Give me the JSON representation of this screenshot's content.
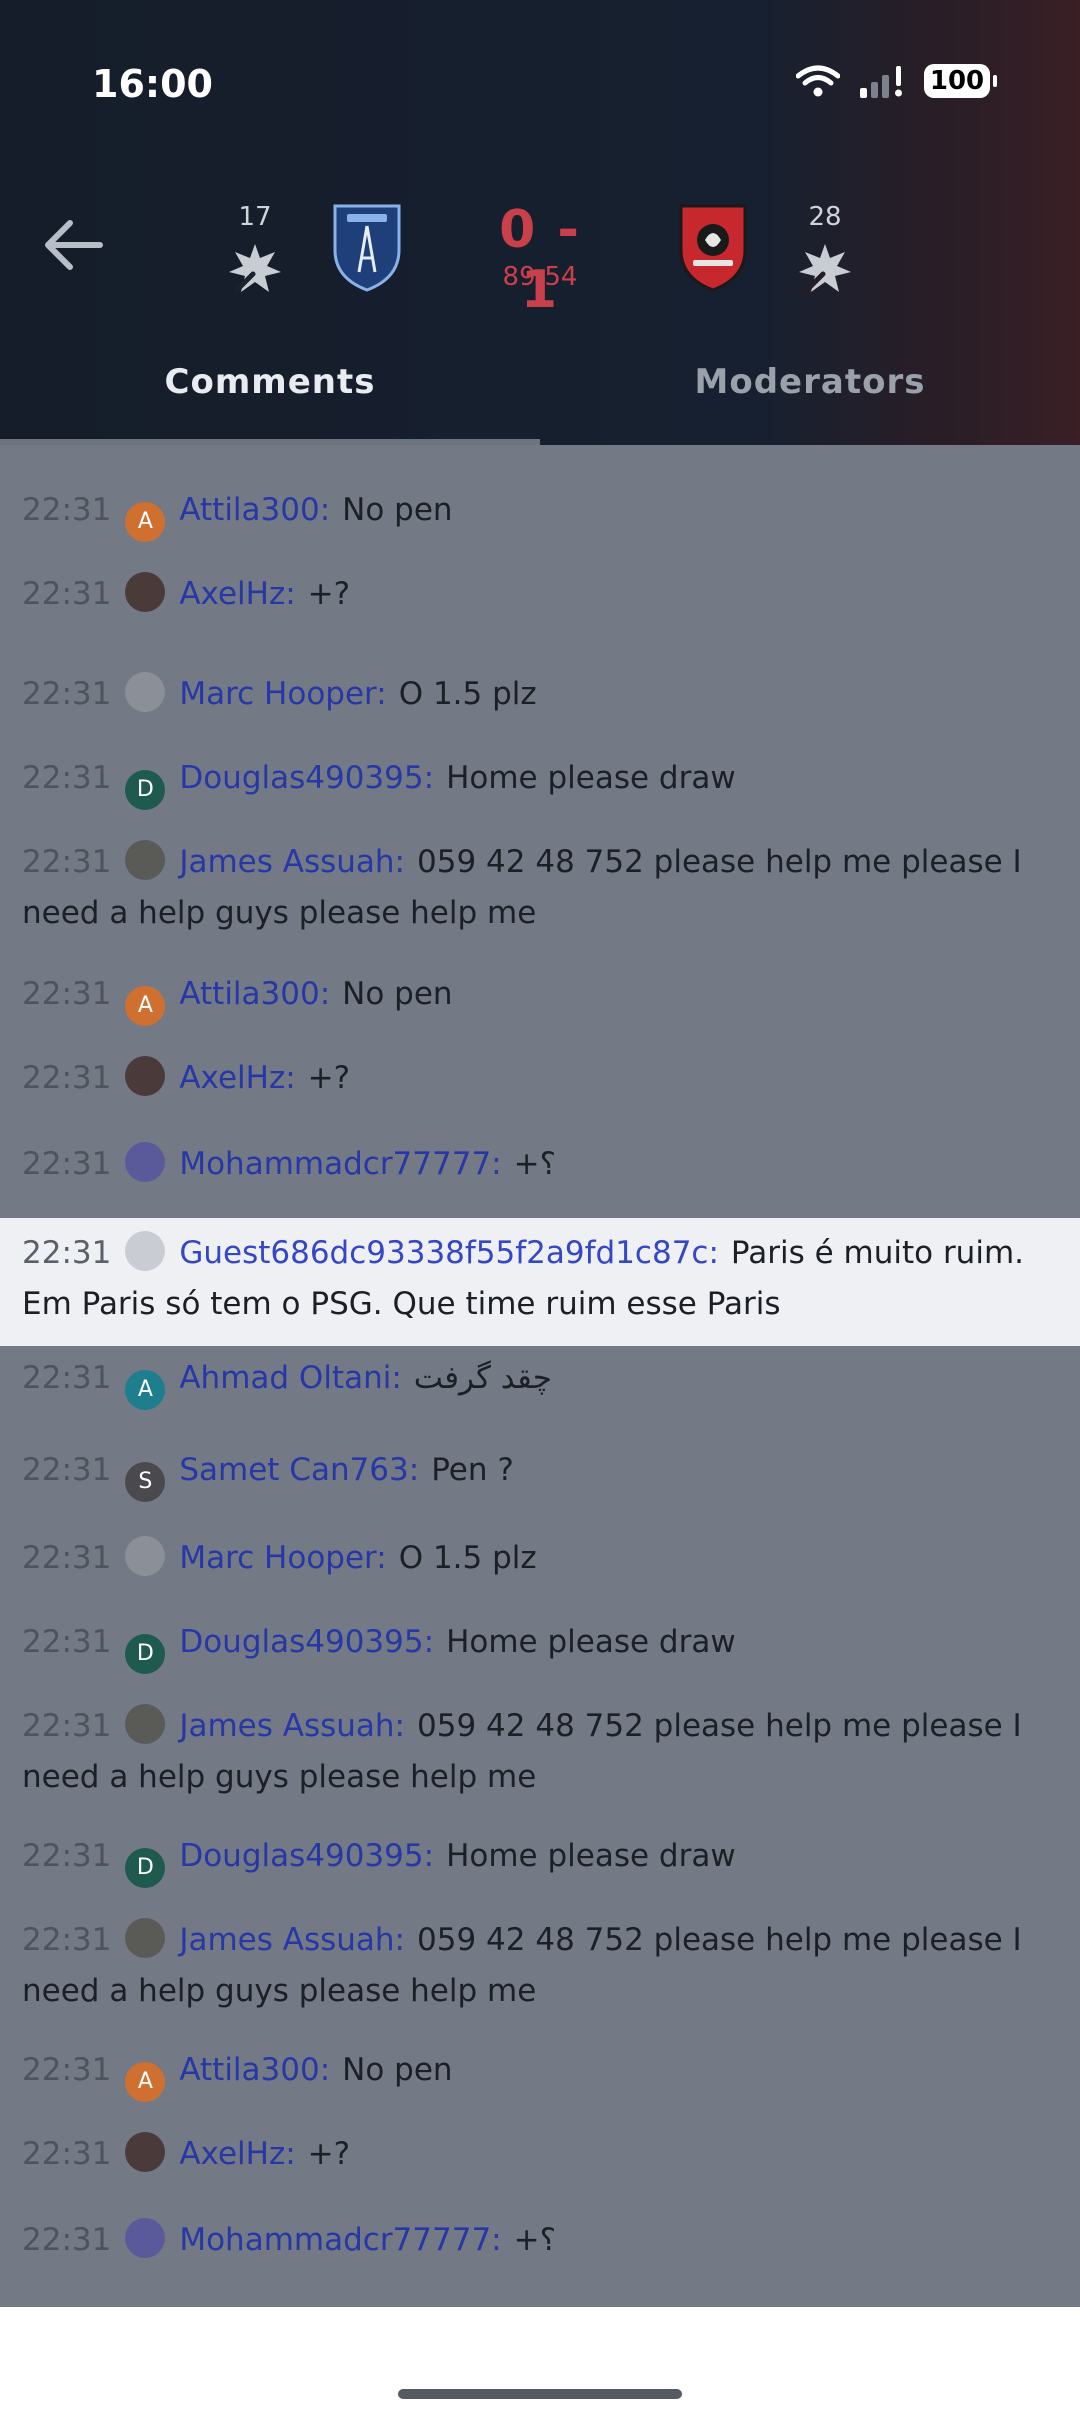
{
  "status": {
    "time": "16:00",
    "battery": "100"
  },
  "match": {
    "home_count": "17",
    "away_count": "28",
    "score": "0 - 1",
    "clock": "89:54",
    "home_colors": [
      "#1f3f7a",
      "#8ab2e8"
    ],
    "away_colors": [
      "#c7282e",
      "#1a1a1a"
    ]
  },
  "tabs": {
    "comments": "Comments",
    "moderators": "Moderators"
  },
  "comments": [
    {
      "time": "22:31",
      "user": "Attila300:",
      "text": "No pen",
      "avatar": "A",
      "avatar_color": "#d07030"
    },
    {
      "time": "22:31",
      "user": "AxelHz:",
      "text": "+?",
      "avatar": "",
      "avatar_color": "#4a3a3a"
    },
    {
      "time": "22:31",
      "user": "Marc Hooper:",
      "text": "O 1.5 plz",
      "avatar": "",
      "avatar_color": "#8a8f98"
    },
    {
      "time": "22:31",
      "user": "Douglas490395:",
      "text": "Home please draw",
      "avatar": "D",
      "avatar_color": "#1e5a4e"
    },
    {
      "time": "22:31",
      "user": "James Assuah:",
      "text": "059 42 48 752 please help me please I need a help guys please help me",
      "avatar": "",
      "avatar_color": "#5a5a56"
    },
    {
      "time": "22:31",
      "user": "Attila300:",
      "text": "No pen",
      "avatar": "A",
      "avatar_color": "#d07030"
    },
    {
      "time": "22:31",
      "user": "AxelHz:",
      "text": "+?",
      "avatar": "",
      "avatar_color": "#4a3a3a"
    },
    {
      "time": "22:31",
      "user": "Mohammadcr77777:",
      "text": "+؟",
      "avatar": "",
      "avatar_color": "#5a5a9a"
    },
    {
      "time": "22:31",
      "user": "Guest686dc93338f55f2a9fd1c87c:",
      "text": "Paris é muito ruim. Em Paris só tem o PSG. Que time ruim esse Paris",
      "avatar": "",
      "avatar_color": "#c9ccd2"
    },
    {
      "time": "22:31",
      "user": "Ahmad Oltani:",
      "text": "چقد گرفت",
      "avatar": "A",
      "avatar_color": "#1e7e8e"
    },
    {
      "time": "22:31",
      "user": "Samet Can763:",
      "text": "Pen ?",
      "avatar": "S",
      "avatar_color": "#4a4a4e"
    },
    {
      "time": "22:31",
      "user": "Marc Hooper:",
      "text": "O 1.5 plz",
      "avatar": "",
      "avatar_color": "#8a8f98"
    },
    {
      "time": "22:31",
      "user": "Douglas490395:",
      "text": "Home please draw",
      "avatar": "D",
      "avatar_color": "#1e5a4e"
    },
    {
      "time": "22:31",
      "user": "James Assuah:",
      "text": "059 42 48 752 please help me please I need a help guys please help me",
      "avatar": "",
      "avatar_color": "#5a5a56"
    },
    {
      "time": "22:31",
      "user": "Douglas490395:",
      "text": "Home please draw",
      "avatar": "D",
      "avatar_color": "#1e5a4e"
    },
    {
      "time": "22:31",
      "user": "James Assuah:",
      "text": "059 42 48 752 please help me please I need a help guys please help me",
      "avatar": "",
      "avatar_color": "#5a5a56"
    },
    {
      "time": "22:31",
      "user": "Attila300:",
      "text": "No pen",
      "avatar": "A",
      "avatar_color": "#d07030"
    },
    {
      "time": "22:31",
      "user": "AxelHz:",
      "text": "+?",
      "avatar": "",
      "avatar_color": "#4a3a3a"
    },
    {
      "time": "22:31",
      "user": "Mohammadcr77777:",
      "text": "+؟",
      "avatar": "",
      "avatar_color": "#5a5a9a"
    }
  ]
}
